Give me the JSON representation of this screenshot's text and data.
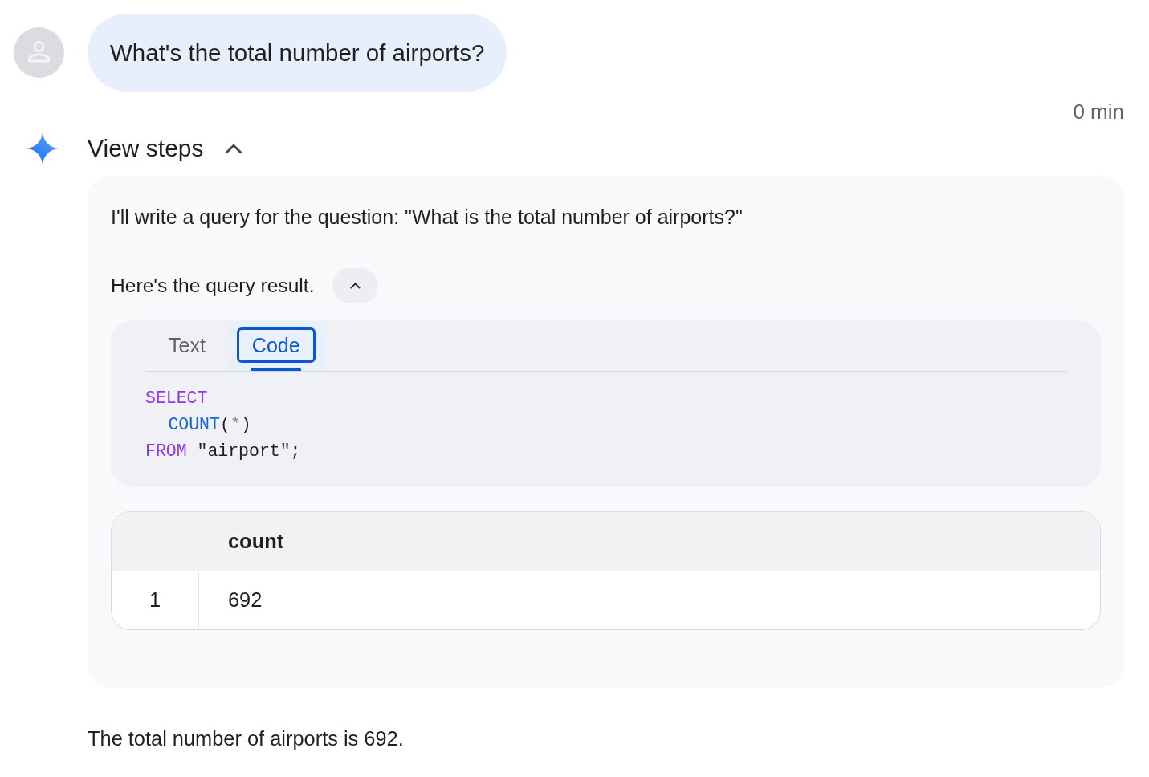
{
  "user_message": {
    "text": "What's the total number of airports?"
  },
  "timestamp": "0 min",
  "steps": {
    "title": "View steps",
    "expanded": true,
    "intro": "I'll write a query for the question: \"What is the total number of airports?\"",
    "result": {
      "label": "Here's the query result.",
      "expanded": true,
      "tabs": [
        {
          "label": "Text",
          "selected": false,
          "focused": false
        },
        {
          "label": "Code",
          "selected": true,
          "focused": true
        }
      ],
      "code": [
        {
          "tokens": [
            {
              "text": "SELECT",
              "kind": "keyword"
            }
          ],
          "children": [
            {
              "tokens": [
                {
                  "text": "COUNT",
                  "kind": "function"
                },
                {
                  "text": "(",
                  "kind": "punct"
                },
                {
                  "text": "*",
                  "kind": "operator"
                },
                {
                  "text": ")",
                  "kind": "punct"
                }
              ]
            }
          ]
        },
        {
          "tokens": [
            {
              "text": "FROM",
              "kind": "keyword"
            },
            {
              "text": "\"airport\";",
              "kind": "plain",
              "spaced": true
            }
          ]
        }
      ],
      "table": {
        "columns": [
          "count"
        ],
        "rows": [
          {
            "index": "1",
            "cells": [
              "692"
            ]
          }
        ]
      }
    }
  },
  "answer": "The total number of airports is 692."
}
